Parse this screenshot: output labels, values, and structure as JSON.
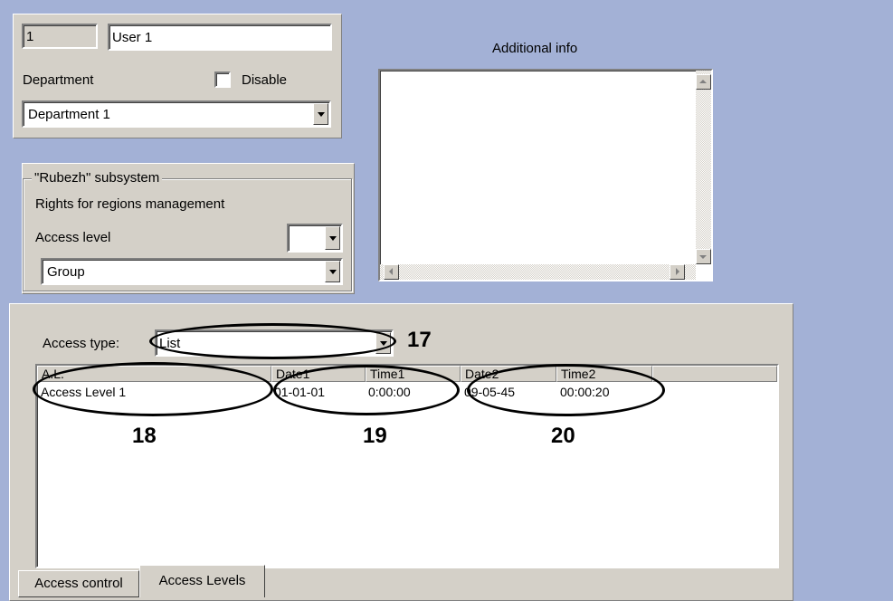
{
  "user": {
    "id_value": "1",
    "name_value": "User 1",
    "department_label": "Department",
    "disable_label": "Disable",
    "disable_checked": false,
    "department_value": "Department 1"
  },
  "additional_info": {
    "label": "Additional info",
    "value": ""
  },
  "rubezh": {
    "group_title": "\"Rubezh\" subsystem",
    "rights_label": "Rights for regions management",
    "access_level_label": "Access level",
    "access_level_value": "",
    "group_value": "Group"
  },
  "access": {
    "type_label": "Access type:",
    "type_value": "List",
    "columns": [
      "A.L.",
      "Date1",
      "Time1",
      "Date2",
      "Time2"
    ],
    "rows": [
      [
        "Access Level 1",
        "01-01-01",
        "0:00:00",
        "09-05-45",
        "00:00:20"
      ]
    ]
  },
  "callouts": [
    "17",
    "18",
    "19",
    "20"
  ],
  "tabs": [
    "Access control",
    "Access Levels"
  ],
  "active_tab": "Access Levels",
  "colors": {
    "background": "#a3b1d6",
    "panel": "#d4d0c8",
    "field": "#ffffff",
    "annotation": "#000000"
  }
}
